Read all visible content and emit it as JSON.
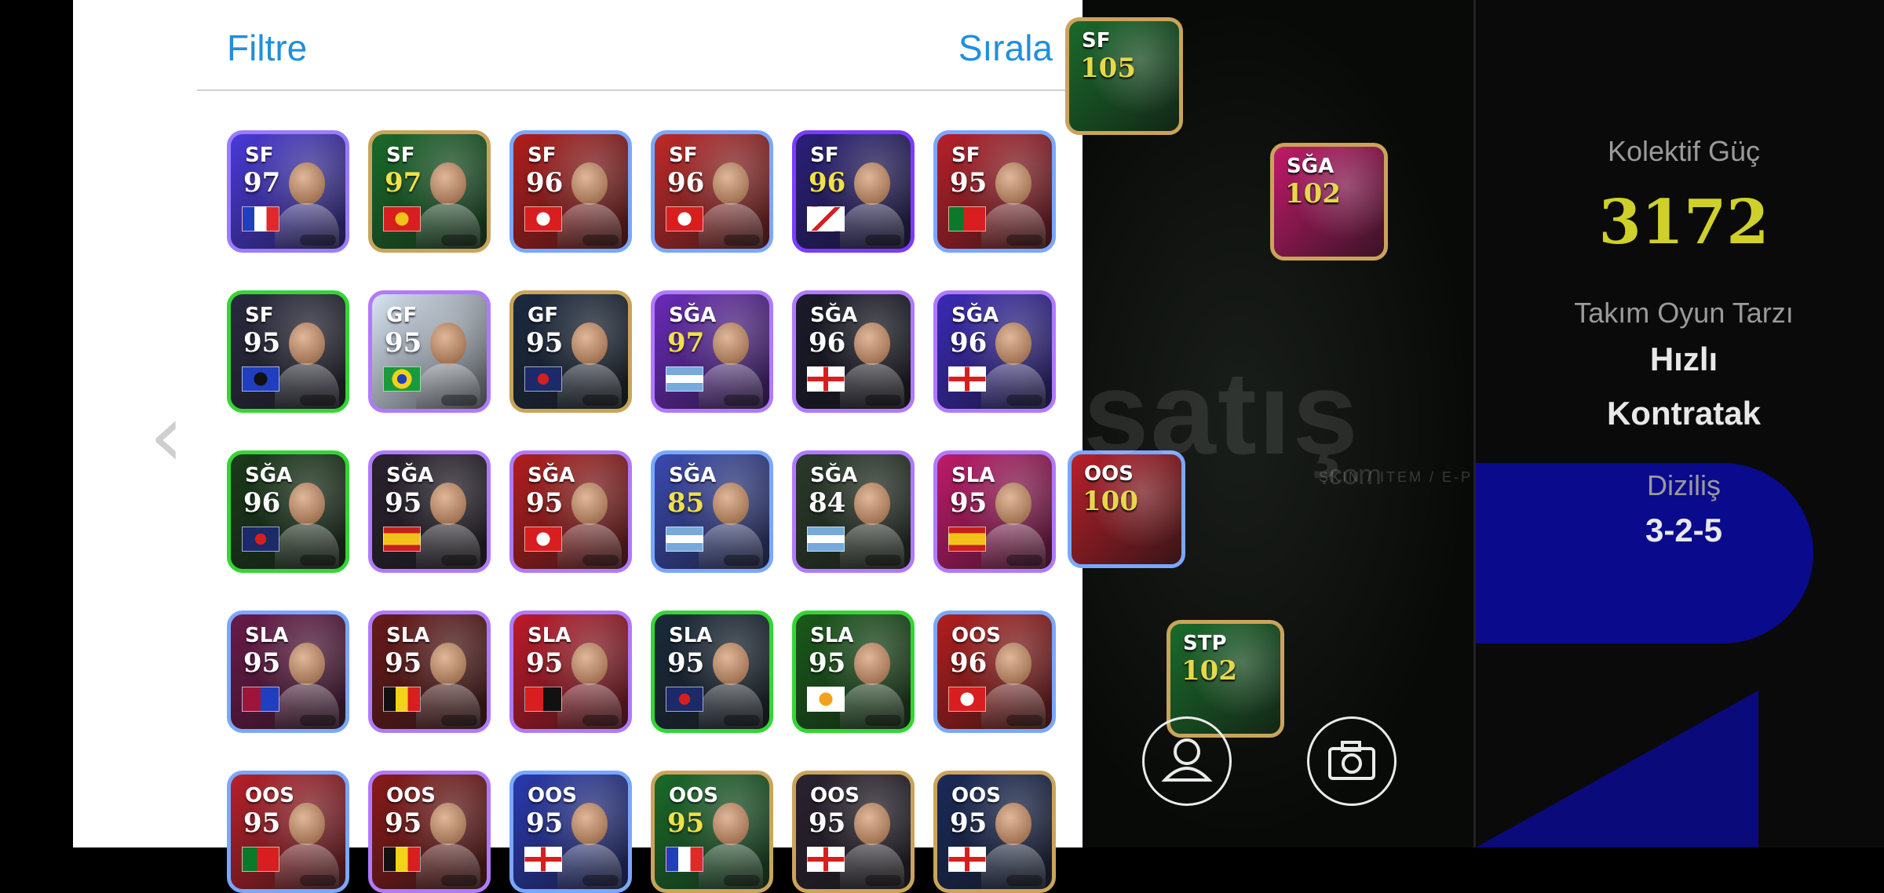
{
  "header": {
    "filter_label": "Filtre",
    "sort_label": "Sırala"
  },
  "cards": [
    {
      "pos": "SF",
      "rating": "97",
      "flag": "france",
      "theme": "#4a3adb",
      "border": "#9a7cff"
    },
    {
      "pos": "SF",
      "rating": "97",
      "flag": "manutd",
      "theme": "#1a6b2a",
      "border": "#c9a45a",
      "gold": true
    },
    {
      "pos": "SF",
      "rating": "96",
      "flag": "bayern",
      "theme": "#b31e1e",
      "border": "#7aa7ff"
    },
    {
      "pos": "SF",
      "rating": "96",
      "flag": "bayern",
      "theme": "#c02a2a",
      "border": "#7aa7ff"
    },
    {
      "pos": "SF",
      "rating": "96",
      "flag": "river",
      "theme": "#2a1f7a",
      "border": "#7a3cff",
      "gold": true
    },
    {
      "pos": "SF",
      "rating": "95",
      "flag": "portugal",
      "theme": "#b8202a",
      "border": "#7aa7ff"
    },
    {
      "pos": "SF",
      "rating": "95",
      "flag": "inter",
      "theme": "#2a2a40",
      "border": "#33d633"
    },
    {
      "pos": "GF",
      "rating": "95",
      "flag": "brazil",
      "theme": "#d9e6f5",
      "border": "#b07aff"
    },
    {
      "pos": "GF",
      "rating": "95",
      "flag": "psg",
      "theme": "#1c2a40",
      "border": "#c9a45a"
    },
    {
      "pos": "SĞA",
      "rating": "97",
      "flag": "argentina",
      "theme": "#6a2ab8",
      "border": "#b07aff",
      "gold": true
    },
    {
      "pos": "SĞA",
      "rating": "96",
      "flag": "england",
      "theme": "#1a1a2a",
      "border": "#b07aff"
    },
    {
      "pos": "SĞA",
      "rating": "96",
      "flag": "england",
      "theme": "#3a2ab8",
      "border": "#b07aff"
    },
    {
      "pos": "SĞA",
      "rating": "96",
      "flag": "psg",
      "theme": "#1a3a1a",
      "border": "#33d633"
    },
    {
      "pos": "SĞA",
      "rating": "95",
      "flag": "spain",
      "theme": "#2a2230",
      "border": "#b07aff"
    },
    {
      "pos": "SĞA",
      "rating": "95",
      "flag": "bayern",
      "theme": "#b31e1e",
      "border": "#b07aff"
    },
    {
      "pos": "SĞA",
      "rating": "85",
      "flag": "argentina",
      "theme": "#3a4ab0",
      "border": "#7aa7ff",
      "gold": true
    },
    {
      "pos": "SĞA",
      "rating": "84",
      "flag": "argentina",
      "theme": "#2a3a2a",
      "border": "#b07aff"
    },
    {
      "pos": "SLA",
      "rating": "95",
      "flag": "spain",
      "theme": "#c01a6a",
      "border": "#b07aff"
    },
    {
      "pos": "SLA",
      "rating": "95",
      "flag": "barca",
      "theme": "#6a1a4a",
      "border": "#7aa7ff"
    },
    {
      "pos": "SLA",
      "rating": "95",
      "flag": "belgium",
      "theme": "#6a1a1a",
      "border": "#b07aff"
    },
    {
      "pos": "SLA",
      "rating": "95",
      "flag": "milan",
      "theme": "#c01a2a",
      "border": "#b07aff"
    },
    {
      "pos": "SLA",
      "rating": "95",
      "flag": "psg",
      "theme": "#1a2a3a",
      "border": "#33d633"
    },
    {
      "pos": "SLA",
      "rating": "95",
      "flag": "valencia",
      "theme": "#1a5a1a",
      "border": "#33d633"
    },
    {
      "pos": "OOS",
      "rating": "96",
      "flag": "bayern",
      "theme": "#b31e1e",
      "border": "#7aa7ff"
    },
    {
      "pos": "OOS",
      "rating": "95",
      "flag": "portugal",
      "theme": "#b8202a",
      "border": "#7aa7ff"
    },
    {
      "pos": "OOS",
      "rating": "95",
      "flag": "belgium",
      "theme": "#8a1a1a",
      "border": "#b07aff"
    },
    {
      "pos": "OOS",
      "rating": "95",
      "flag": "england",
      "theme": "#2a3ab0",
      "border": "#7aa7ff"
    },
    {
      "pos": "OOS",
      "rating": "95",
      "flag": "france",
      "theme": "#1a6b2a",
      "border": "#c9a45a",
      "gold": true
    },
    {
      "pos": "OOS",
      "rating": "95",
      "flag": "england",
      "theme": "#2a2230",
      "border": "#c9a45a"
    },
    {
      "pos": "OOS",
      "rating": "95",
      "flag": "england",
      "theme": "#1a2a5a",
      "border": "#c9a45a"
    }
  ],
  "field_cards": [
    {
      "pos": "SF",
      "rating": "105",
      "theme": "#1a6b2a",
      "border": "#c9a45a"
    },
    {
      "pos": "SĞA",
      "rating": "102",
      "theme": "#c01a6a",
      "border": "#c9a45a"
    },
    {
      "pos": "OOS",
      "rating": "100",
      "theme": "#b8202a",
      "border": "#7aa7ff"
    },
    {
      "pos": "STP",
      "rating": "102",
      "theme": "#1a6b2a",
      "border": "#c9a45a"
    }
  ],
  "watermark": {
    "main": "satış",
    "sub": "SKIN / ITEM / E-PIN",
    "com": ".com"
  },
  "info": {
    "collective_label": "Kolektif Güç",
    "collective_value": "3172",
    "playstyle_label": "Takım Oyun Tarzı",
    "playstyle_line1": "Hızlı",
    "playstyle_line2": "Kontratak",
    "formation_label": "Diziliş",
    "formation_value": "3-2-5"
  },
  "icons": {
    "back": "chevron-left-icon",
    "profile": "person-icon",
    "camera": "camera-icon"
  }
}
